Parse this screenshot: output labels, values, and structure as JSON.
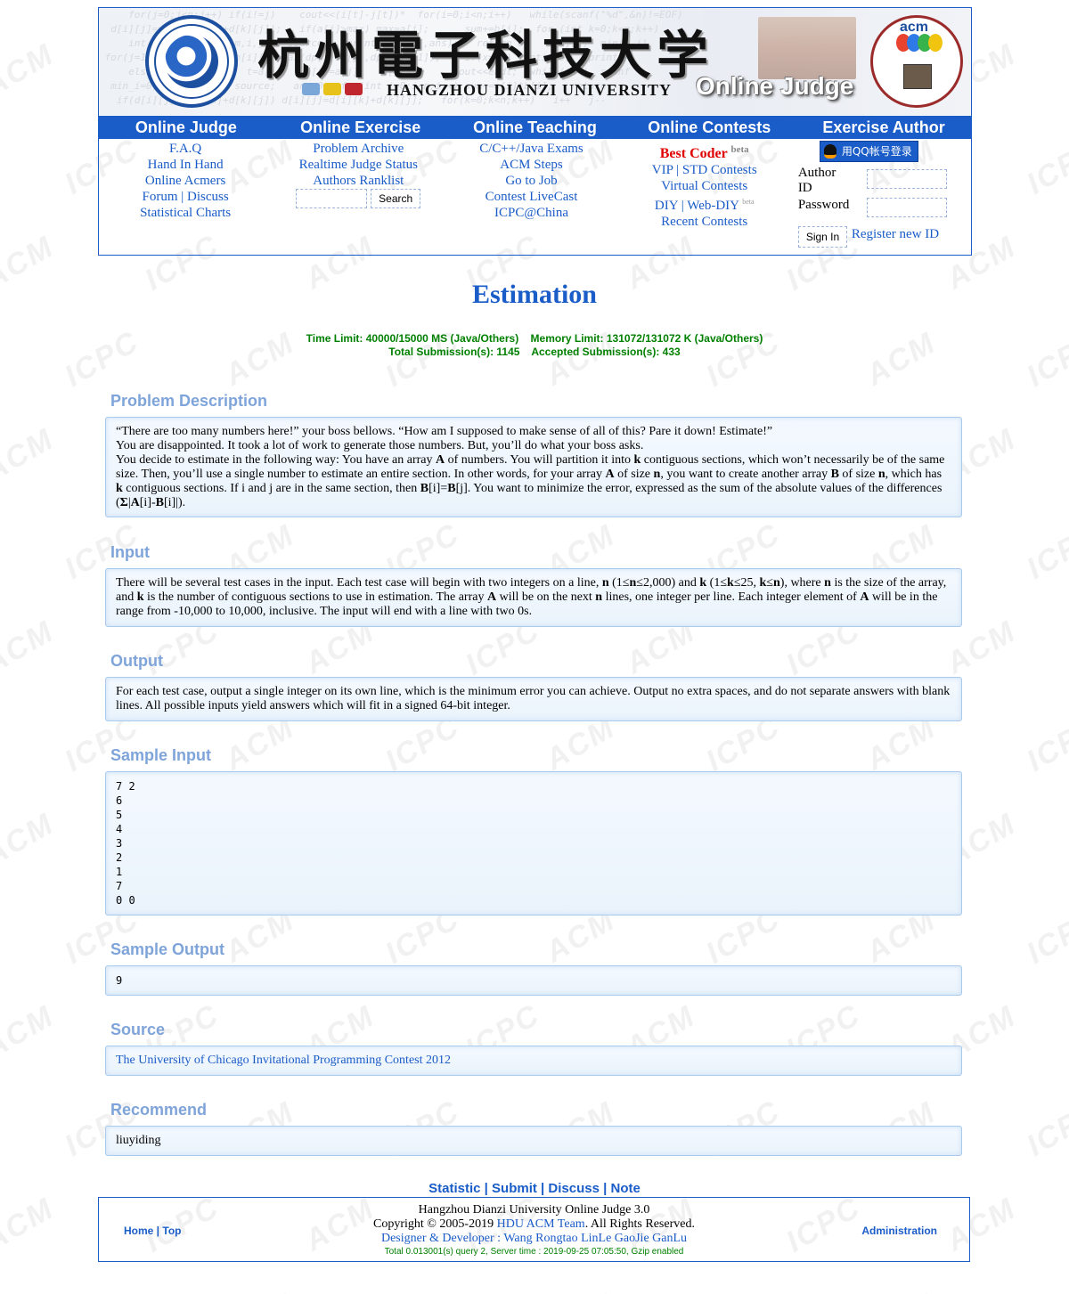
{
  "banner": {
    "cn_title": "杭州電子科技大学",
    "en_title": "HANGZHOU DIANZI UNIVERSITY",
    "oj_title": "Online Judge",
    "acm_logo_text": "acm"
  },
  "nav": {
    "headers": [
      "Online Judge",
      "Online Exercise",
      "Online Teaching",
      "Online Contests",
      "Exercise Author"
    ],
    "col1": [
      "F.A.Q",
      "Hand In Hand",
      "Online Acmers",
      "Forum",
      "Discuss",
      "Statistical Charts"
    ],
    "col2": [
      "Problem Archive",
      "Realtime Judge Status",
      "Authors Ranklist"
    ],
    "search_button": "Search",
    "col3": [
      "C/C++/Java Exams",
      "ACM Steps",
      "Go to Job",
      "Contest LiveCast",
      "ICPC@China"
    ],
    "col4": {
      "best_coder": "Best Coder",
      "beta": "beta",
      "vip": "VIP",
      "std": "STD Contests",
      "virtual": "Virtual Contests",
      "diy": "DIY",
      "webdiy": "Web-DIY",
      "recent": "Recent Contests"
    },
    "login": {
      "qq_button": "用QQ帐号登录",
      "author_id_label": "Author ID",
      "password_label": "Password",
      "sign_in": "Sign In",
      "register": "Register new ID"
    }
  },
  "problem": {
    "title": "Estimation",
    "limits_line1": "Time Limit: 40000/15000 MS (Java/Others)    Memory Limit: 131072/131072 K (Java/Others)",
    "limits_line2": "Total Submission(s): 1145    Accepted Submission(s): 433",
    "sections": {
      "description": "Problem Description",
      "input": "Input",
      "output": "Output",
      "sample_input": "Sample Input",
      "sample_output": "Sample Output",
      "source": "Source",
      "recommend": "Recommend"
    },
    "desc_p1": "“There are too many numbers here!” your boss bellows. “How am I supposed to make sense of all of this? Pare it down! Estimate!”",
    "desc_p2": "You are disappointed. It took a lot of work to generate those numbers. But, you’ll do what your boss asks.",
    "input_text": "There will be several test cases in the input. Each test case will begin with two integers on a line, n (1≤n≤2,000) and k (1≤k≤25, k≤n), where n is the size of the array, and k is the number of contiguous sections to use in estimation. The array A will be on the next n lines, one integer per line. Each integer element of A will be in the range from -10,000 to 10,000, inclusive. The input will end with a line with two 0s.",
    "output_text": "For each test case, output a single integer on its own line, which is the minimum error you can achieve. Output no extra spaces, and do not separate answers with blank lines. All possible inputs yield answers which will fit in a signed 64-bit integer.",
    "sample_input": "7 2\n6\n5\n4\n3\n2\n1\n7\n0 0",
    "sample_output": "9",
    "source": "The University of Chicago Invitational Programming Contest 2012",
    "recommend": "liuyiding"
  },
  "bottom_links": [
    "Statistic",
    "Submit",
    "Discuss",
    "Note"
  ],
  "footer": {
    "home": "Home",
    "top": "Top",
    "admin": "Administration",
    "line1": "Hangzhou Dianzi University Online Judge 3.0",
    "copyright_pre": "Copyright © 2005-2019 ",
    "team": "HDU ACM Team",
    "copyright_post": ". All Rights Reserved.",
    "designer": "Designer & Developer : Wang Rongtao LinLe GaoJie GanLu",
    "stats": "Total 0.013001(s) query 2, Server time : 2019-09-25 07:05:50, Gzip enabled"
  },
  "colors": {
    "brand_blue": "#1a5cc8",
    "section_head": "#7ea4da",
    "limits_green": "#008000",
    "best_coder_red": "#e00000"
  }
}
